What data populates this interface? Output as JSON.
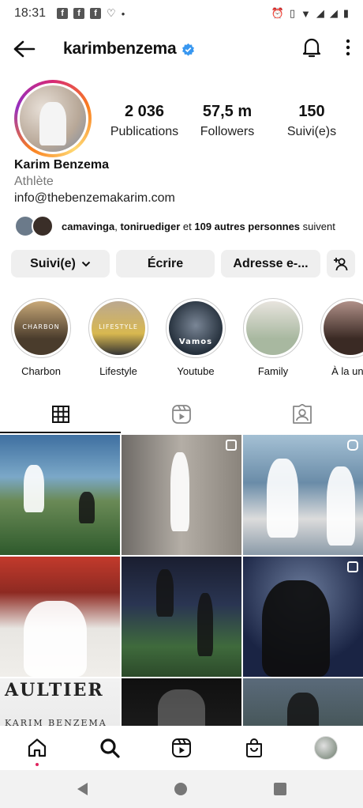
{
  "status_bar": {
    "time": "18:31",
    "dot": "•"
  },
  "header": {
    "username": "karimbenzema",
    "verified": true
  },
  "profile": {
    "stats": [
      {
        "num": "2 036",
        "label": "Publications"
      },
      {
        "num": "57,5 m",
        "label": "Followers"
      },
      {
        "num": "150",
        "label": "Suivi(e)s"
      }
    ],
    "name": "Karim Benzema",
    "category": "Athlète",
    "email": "info@thebenzemakarim.com"
  },
  "followed_by": {
    "user1": "camavinga",
    "sep": ", ",
    "user2": "toniruediger",
    "mid": " et ",
    "others": "109 autres personnes",
    "tail": " suivent"
  },
  "actions": {
    "follow_label": "Suivi(e)",
    "message_label": "Écrire",
    "address_label": "Adresse e-..."
  },
  "highlights": [
    {
      "label": "Charbon",
      "tag": "CHARBON"
    },
    {
      "label": "Lifestyle",
      "tag": "LIFESTYLE"
    },
    {
      "label": "Youtube",
      "tag": "Vamos"
    },
    {
      "label": "Family",
      "tag": ""
    },
    {
      "label": "À la une",
      "tag": ""
    }
  ],
  "posts": [
    {
      "text": ""
    },
    {
      "text": ""
    },
    {
      "text": ""
    },
    {
      "text": ""
    },
    {
      "text": ""
    },
    {
      "text": ""
    },
    {
      "text": "AULTIER"
    },
    {
      "text": ""
    },
    {
      "text": ""
    }
  ],
  "post7_subtext": "KARIM BENZEMA",
  "icons": {
    "back": "arrow-left-icon",
    "bell": "bell-icon",
    "more": "more-vertical-icon",
    "grid": "grid-icon",
    "reels": "reels-icon",
    "tagged": "tagged-icon",
    "home": "home-icon",
    "search": "search-icon",
    "shop": "shop-icon"
  },
  "colors": {
    "verified": "#3897f0",
    "notification_dot": "#e0245e"
  }
}
